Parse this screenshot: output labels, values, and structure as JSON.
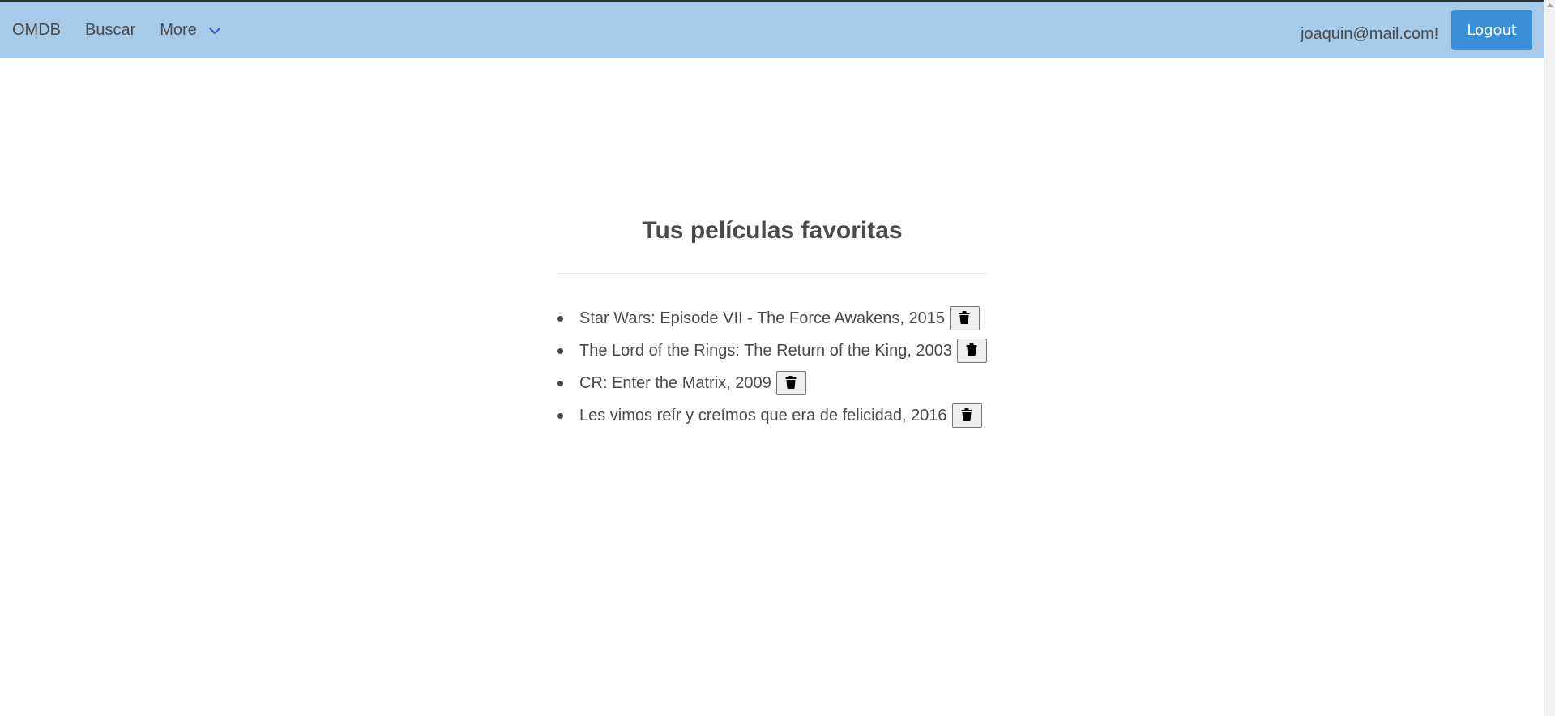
{
  "navbar": {
    "brand": "OMDB",
    "links": [
      {
        "label": "Buscar"
      },
      {
        "label": "More"
      }
    ],
    "user_email": "joaquin@mail.com!",
    "logout_label": "Logout",
    "chevron_icon": "chevron-down-icon",
    "background": "#a8cae9",
    "logout_color": "#3a8fd6"
  },
  "main": {
    "title": "Tus películas favoritas",
    "favorites": [
      {
        "text": "Star Wars: Episode VII - The Force Awakens, 2015",
        "icon": "trash-icon"
      },
      {
        "text": "The Lord of the Rings: The Return of the King, 2003",
        "icon": "trash-icon"
      },
      {
        "text": "CR: Enter the Matrix, 2009",
        "icon": "trash-icon"
      },
      {
        "text": "Les vimos reír y creímos que era de felicidad, 2016",
        "icon": "trash-icon"
      }
    ]
  }
}
